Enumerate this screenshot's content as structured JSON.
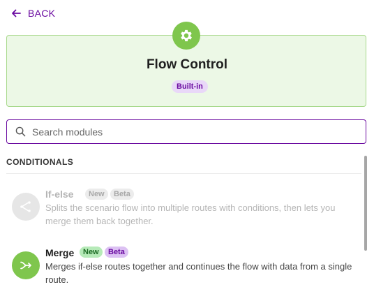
{
  "nav": {
    "back_label": "BACK"
  },
  "header": {
    "title": "Flow Control",
    "badge": "Built-in",
    "icon": "gear-icon",
    "colors": {
      "accent": "#7fc64d",
      "background": "#ecf8e6",
      "border": "#a8d98c"
    }
  },
  "search": {
    "placeholder": "Search modules",
    "value": ""
  },
  "section": {
    "title": "CONDITIONALS"
  },
  "modules": [
    {
      "name": "If-else",
      "badges": [
        "New",
        "Beta"
      ],
      "description": "Splits the scenario flow into multiple routes with conditions, then lets you merge them back together.",
      "icon": "split-icon",
      "state": "disabled"
    },
    {
      "name": "Merge",
      "badges": [
        "New",
        "Beta"
      ],
      "description": "Merges if-else routes together and continues the flow with data from a single route.",
      "icon": "merge-icon",
      "state": "enabled"
    }
  ],
  "colors": {
    "brand": "#6a0aa0",
    "new_badge": "#b6eab8",
    "beta_badge": "#dcc1f3"
  }
}
